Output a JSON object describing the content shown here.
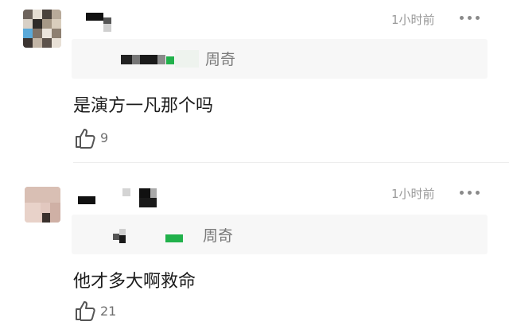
{
  "comments": [
    {
      "time": "1小时前",
      "quote_author": "周奇",
      "text": "是演方一凡那个吗",
      "likes": "9"
    },
    {
      "time": "1小时前",
      "quote_author": "周奇",
      "text": "他才多大啊救命",
      "likes": "21"
    }
  ],
  "colors": {
    "badge_green": "#21b14b",
    "time_gray": "#9a9a9a",
    "quote_bg": "#f7f7f7"
  },
  "icons": [
    "more-dots-icon",
    "thumbs-up-icon"
  ]
}
